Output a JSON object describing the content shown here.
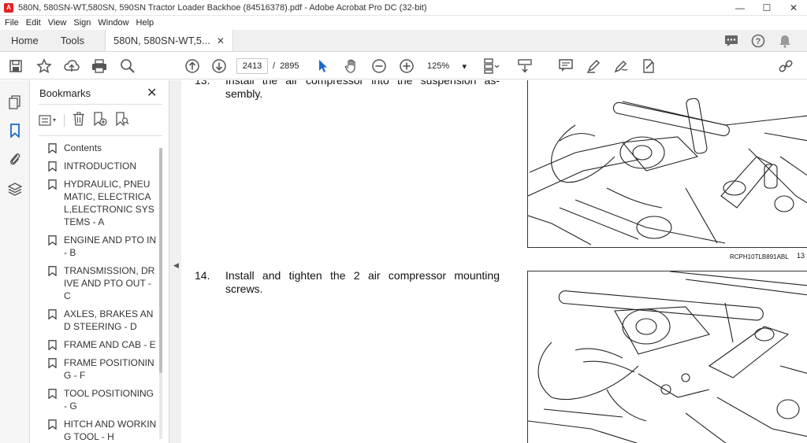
{
  "window": {
    "title": "580N, 580SN-WT,580SN, 590SN Tractor Loader Backhoe (84516378).pdf - Adobe Acrobat Pro DC (32-bit)",
    "minimize": "—",
    "maximize": "☐",
    "close": "✕"
  },
  "menu": [
    "File",
    "Edit",
    "View",
    "Sign",
    "Window",
    "Help"
  ],
  "tabs": {
    "home": "Home",
    "tools": "Tools",
    "document": "580N, 580SN-WT,5...",
    "close": "✕"
  },
  "toolbar": {
    "current_page": "2413",
    "page_separator": "/",
    "total_pages": "2895",
    "zoom": "125%"
  },
  "bookmarks": {
    "title": "Bookmarks",
    "close": "✕",
    "items": [
      "Contents",
      "INTRODUCTION",
      "HYDRAULIC, PNEUMATIC, ELECTRICAL,ELECTRONIC SYSTEMS - A",
      "ENGINE AND PTO IN - B",
      "TRANSMISSION, DRIVE AND PTO OUT - C",
      "AXLES, BRAKES AND STEERING - D",
      "FRAME AND CAB - E",
      "FRAME POSITIONING - F",
      "TOOL POSITIONING - G",
      "HITCH AND WORKING TOOL - H"
    ]
  },
  "document": {
    "step13": {
      "number": "13.",
      "text": "Install the air compressor into the suspension as-sembly."
    },
    "figure13_caption": "RCPH10TLB891ABL",
    "figure13_number": "13",
    "step14": {
      "number": "14.",
      "text": "Install and tighten the 2 air compressor mounting screws."
    }
  }
}
